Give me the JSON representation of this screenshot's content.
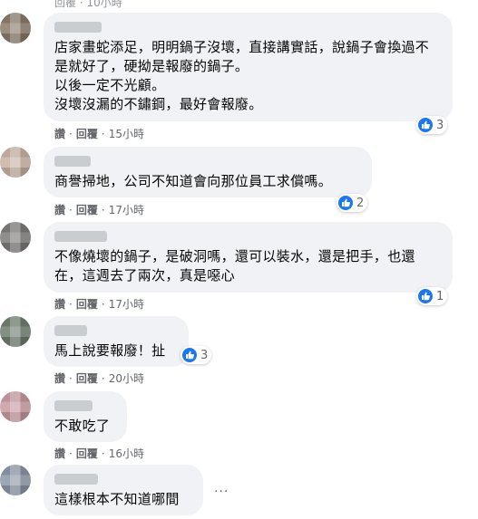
{
  "top_partial": {
    "reply": "回覆",
    "time": "10小時"
  },
  "comments": [
    {
      "text": "店家畫蛇添足，明明鍋子沒壞，直接講實話，說鍋子會換過不是就好了，硬拗是報廢的鍋子。\n以後一定不光顧。\n沒壞沒漏的不鏽鋼，最好會報廢。",
      "like": "讚",
      "reply": "回覆",
      "time": "15小時",
      "reaction_count": "3",
      "avatar_color": "#8a7a6a"
    },
    {
      "text": "商譽掃地，公司不知道會向那位員工求償嗎。",
      "like": "讚",
      "reply": "回覆",
      "time": "17小時",
      "reaction_count": "2",
      "avatar_color": "#c8b2a3"
    },
    {
      "text": "不像燒壞的鍋子，是破洞嗎，還可以裝水，還是把手，也還在，這週去了兩次，真是噁心",
      "like": "讚",
      "reply": "回覆",
      "time": "17小時",
      "reaction_count": "1",
      "avatar_color": "#7d7a78"
    },
    {
      "text": "馬上說要報廢！扯",
      "like": "讚",
      "reply": "回覆",
      "time": "20小時",
      "reaction_count": "3",
      "avatar_color": "#6f7d6e"
    },
    {
      "text": "不敢吃了",
      "like": "讚",
      "reply": "回覆",
      "time": "16小時",
      "reaction_count": "",
      "avatar_color": "#c79aa0"
    },
    {
      "text": "這樣根本不知道哪間",
      "like": "讚",
      "reply": "回覆",
      "time": "",
      "reaction_count": "",
      "more": "···",
      "avatar_color": "#8c96a6"
    }
  ],
  "colors": {
    "bubble": "#f0f2f5",
    "meta": "#65676b",
    "like_blue": "#1877f2"
  },
  "icons": {
    "reaction": "thumbs-up-icon",
    "more": "more-options-icon"
  }
}
